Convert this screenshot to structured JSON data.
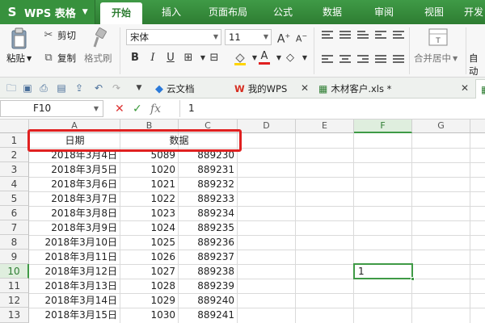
{
  "app": {
    "name": "WPS 表格"
  },
  "menu": {
    "tabs": [
      "开始",
      "插入",
      "页面布局",
      "公式",
      "数据",
      "审阅",
      "视图",
      "开发"
    ],
    "active": "开始"
  },
  "ribbon": {
    "paste_label": "粘贴",
    "cut_label": "剪切",
    "copy_label": "复制",
    "format_painter_label": "格式刷",
    "font_name": "宋体",
    "font_size": "11",
    "bold": "B",
    "italic": "I",
    "underline": "U",
    "font_color_letter": "A",
    "merge_label": "合并居中",
    "auto_label": "自动"
  },
  "doc_tabs": [
    {
      "label": "云文档"
    },
    {
      "label": "我的WPS"
    },
    {
      "label": "木材客户.xls *"
    }
  ],
  "formula_bar": {
    "cell_ref": "F10",
    "fx": "fx",
    "value": "1"
  },
  "sheet": {
    "columns": [
      "A",
      "B",
      "C",
      "D",
      "E",
      "F",
      "G"
    ],
    "selected_column": "F",
    "selected_row": "10",
    "header_row": {
      "a": "日期",
      "b": "数据"
    },
    "rows": [
      {
        "n": "1"
      },
      {
        "n": "2",
        "date": "2018年3月4日",
        "b": "5089",
        "c": "889230"
      },
      {
        "n": "3",
        "date": "2018年3月5日",
        "b": "1020",
        "c": "889231"
      },
      {
        "n": "4",
        "date": "2018年3月6日",
        "b": "1021",
        "c": "889232"
      },
      {
        "n": "5",
        "date": "2018年3月7日",
        "b": "1022",
        "c": "889233"
      },
      {
        "n": "6",
        "date": "2018年3月8日",
        "b": "1023",
        "c": "889234"
      },
      {
        "n": "7",
        "date": "2018年3月9日",
        "b": "1024",
        "c": "889235"
      },
      {
        "n": "8",
        "date": "2018年3月10日",
        "b": "1025",
        "c": "889236"
      },
      {
        "n": "9",
        "date": "2018年3月11日",
        "b": "1026",
        "c": "889237"
      },
      {
        "n": "10",
        "date": "2018年3月12日",
        "b": "1027",
        "c": "889238"
      },
      {
        "n": "11",
        "date": "2018年3月13日",
        "b": "1028",
        "c": "889239"
      },
      {
        "n": "12",
        "date": "2018年3月14日",
        "b": "1029",
        "c": "889240"
      },
      {
        "n": "13",
        "date": "2018年3月15日",
        "b": "1030",
        "c": "889241"
      }
    ],
    "active_cell_value": "1"
  },
  "colors": {
    "brand_green": "#2e7d32",
    "highlight_red": "#e02020",
    "selection_green": "#3f9a46"
  }
}
